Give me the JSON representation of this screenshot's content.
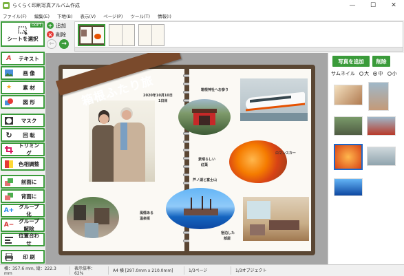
{
  "window": {
    "title": "らくらく印刷写真アルバム作成",
    "minimize": "—",
    "maximize": "☐",
    "close": "✕"
  },
  "menu": [
    "ファイル(F)",
    "編集(E)",
    "下地(B)",
    "表示(V)",
    "ページ(P)",
    "ツール(T)",
    "情報(I)"
  ],
  "toolbar": {
    "select_badge": "OOPT",
    "select_label": "シートを選択",
    "buttons": [
      {
        "label": "テキスト",
        "icon": "text-icon"
      },
      {
        "label": "画 像",
        "icon": "image-icon"
      },
      {
        "label": "素 材",
        "icon": "star-icon"
      },
      {
        "label": "図 形",
        "icon": "shape-icon"
      },
      {
        "label": "マスク",
        "icon": "mask-icon"
      },
      {
        "label": "回 転",
        "icon": "rotate-icon"
      },
      {
        "label": "トリミング",
        "icon": "crop-icon"
      },
      {
        "label": "色相調整",
        "icon": "palette-icon"
      },
      {
        "label": "前面に",
        "icon": "bring-front-icon"
      },
      {
        "label": "背面に",
        "icon": "send-back-icon"
      },
      {
        "label": "グループ化",
        "icon": "group-icon"
      },
      {
        "label": "グループ解除",
        "icon": "ungroup-icon"
      },
      {
        "label": "位置合わせ",
        "icon": "align-icon"
      },
      {
        "label": "印 刷",
        "icon": "printer-icon"
      }
    ]
  },
  "page_controls": {
    "add_label": "追加",
    "delete_label": "削除"
  },
  "album": {
    "title": "箱根ふたり旅",
    "date_line1": "2020年10月10日",
    "date_line2": "1日目",
    "captions": {
      "shrine": "箱根神社へお参り",
      "romancecar": "ロマンスカー",
      "leaves_1": "素晴らしい",
      "leaves_2": "紅葉",
      "lake": "芦ノ湖と富士山",
      "onsen_1": "風情ある",
      "onsen_2": "温泉街",
      "room_1": "宿泊した",
      "room_2": "部屋"
    }
  },
  "right_panel": {
    "add_photo": "写真を追加",
    "delete": "削除",
    "thumb_label": "サムネイル",
    "size_options": [
      "大",
      "中",
      "小"
    ],
    "selected_size": "中"
  },
  "status": {
    "size": "横：357.6 mm, 縦：222.3 mm",
    "zoom": "表示倍率：62%",
    "paper": "A4 横 [297.0mm x 210.0mm]",
    "page": "1/3ページ",
    "object": "1/3オブジェクト"
  },
  "colors": {
    "accent_green": "#3a9b3a",
    "album_cover": "#5a4633",
    "ribbon": "#7a4a2c"
  }
}
